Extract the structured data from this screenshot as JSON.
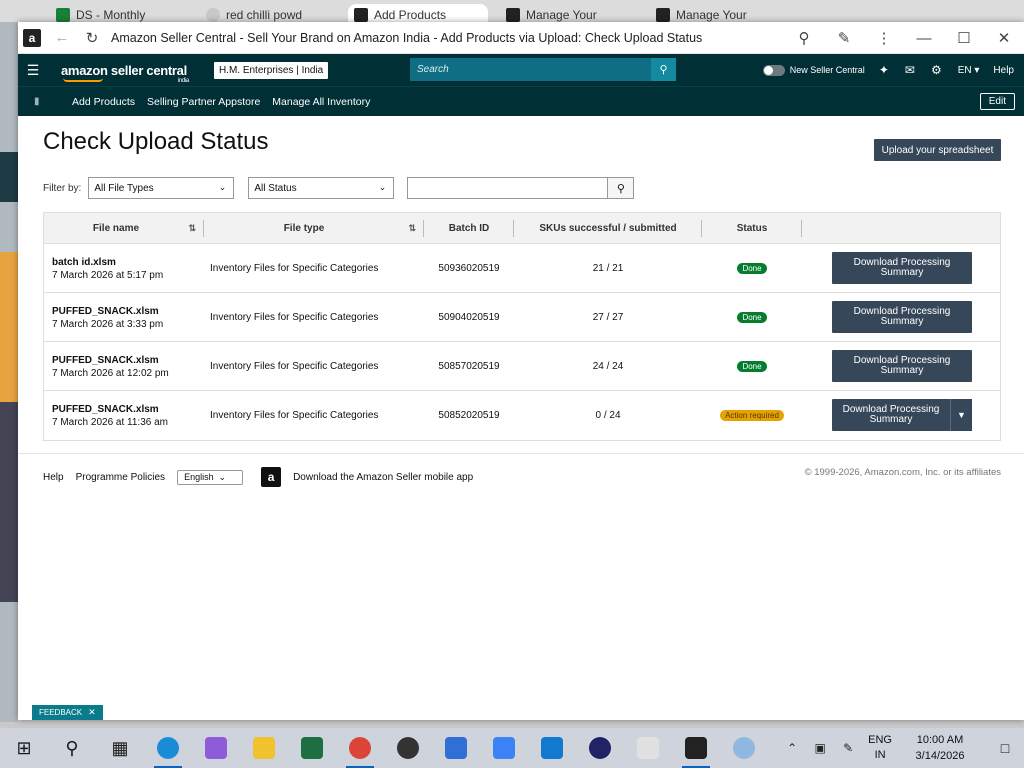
{
  "background_tabs": [
    {
      "label": "DS - Monthly",
      "color": "#188038"
    },
    {
      "label": "red chilli powd",
      "color": "#c8c8c8"
    },
    {
      "label": "Add Products",
      "color": "#222222"
    },
    {
      "label": "Manage Your",
      "color": "#222222"
    },
    {
      "label": "Manage Your",
      "color": "#222222"
    }
  ],
  "window": {
    "title": "Amazon Seller Central - Sell Your Brand on Amazon India - Add Products via Upload: Check Upload Status"
  },
  "nav": {
    "brand": "amazon seller central",
    "brand_sub": "india",
    "account": "H.M. Enterprises",
    "marketplace": "India",
    "search_placeholder": "Search",
    "new_seller_central": "New Seller Central",
    "language": "EN",
    "help": "Help",
    "links": [
      "Add Products",
      "Selling Partner Appstore",
      "Manage All Inventory"
    ],
    "edit": "Edit"
  },
  "page": {
    "title": "Check Upload Status",
    "upload_button": "Upload your spreadsheet",
    "filter_label": "Filter by:",
    "file_type_filter": "All File Types",
    "status_filter": "All Status"
  },
  "table": {
    "columns": [
      "File name",
      "File type",
      "Batch ID",
      "SKUs successful / submitted",
      "Status"
    ],
    "rows": [
      {
        "file": "batch id.xlsm",
        "date": "7 March 2026 at 5:17 pm",
        "type": "Inventory Files for Specific Categories",
        "batch": "50936020519",
        "skus": "21 / 21",
        "status": "Done",
        "action": "Download Processing Summary"
      },
      {
        "file": "PUFFED_SNACK.xlsm",
        "date": "7 March 2026 at 3:33 pm",
        "type": "Inventory Files for Specific Categories",
        "batch": "50904020519",
        "skus": "27 / 27",
        "status": "Done",
        "action": "Download Processing Summary"
      },
      {
        "file": "PUFFED_SNACK.xlsm",
        "date": "7 March 2026 at 12:02 pm",
        "type": "Inventory Files for Specific Categories",
        "batch": "50857020519",
        "skus": "24 / 24",
        "status": "Done",
        "action": "Download Processing Summary"
      },
      {
        "file": "PUFFED_SNACK.xlsm",
        "date": "7 March 2026 at 11:36 am",
        "type": "Inventory Files for Specific Categories",
        "batch": "50852020519",
        "skus": "0 / 24",
        "status": "Action required",
        "action": "Download Processing Summary"
      }
    ]
  },
  "footer": {
    "help": "Help",
    "policies": "Programme Policies",
    "language": "English",
    "app_link": "Download the Amazon Seller mobile app",
    "copyright": "© 1999-2026, Amazon.com, Inc. or its affiliates"
  },
  "feedback": "FEEDBACK",
  "taskbar": {
    "lang_line1": "ENG",
    "lang_line2": "IN",
    "time": "10:00 AM",
    "date": "3/14/2026"
  },
  "colors": {
    "nav_bg": "#002f36",
    "button_bg": "#37475a",
    "done": "#067d2e",
    "action_required": "#e5a302"
  }
}
